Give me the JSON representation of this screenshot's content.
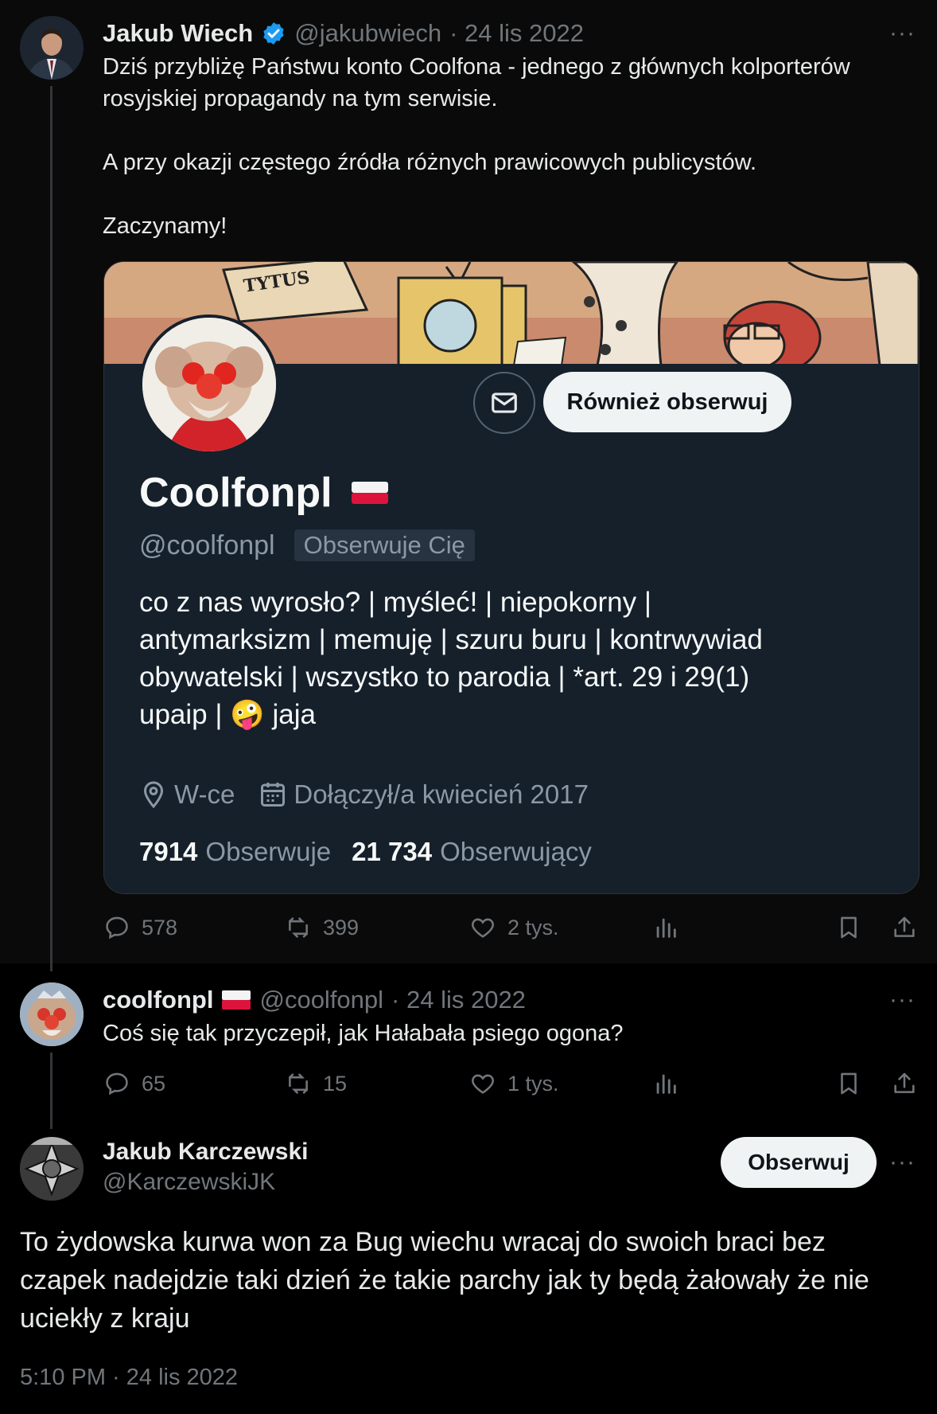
{
  "tweet1": {
    "author_name": "Jakub Wiech",
    "author_handle": "@jakubwiech",
    "date": "· 24 lis 2022",
    "more": "···",
    "text_lines": [
      "Dziś przybliżę Państwu konto Coolfona - jednego z głównych kolporterów",
      "rosyjskiej propagandy na tym serwisie."
    ],
    "text_p2": "A przy okazji częstego źródła różnych prawicowych publicystów.",
    "text_p3": "Zaczynamy!",
    "actions": {
      "replies": "578",
      "retweets": "399",
      "likes": "2 tys."
    }
  },
  "card": {
    "banner_text": "TYTUS",
    "follow_back_label": "Również obserwuj",
    "display_name": "Coolfonpl",
    "handle": "@coolfonpl",
    "follows_you": "Obserwuje Cię",
    "bio_lines": [
      "co z nas wyrosło? | myśleć! | niepokorny |",
      "antymarksizm | memuję | szuru buru | kontrwywiad",
      "obywatelski | wszystko to parodia | *art. 29 i 29(1)",
      "upaip | 🤪 jaja"
    ],
    "location": "W-ce",
    "joined": "Dołączył/a kwiecień 2017",
    "following_count": "7914",
    "following_label": "Obserwuje",
    "followers_count": "21 734",
    "followers_label": "Obserwujący"
  },
  "tweet2": {
    "author_name": "coolfonpl",
    "author_handle": "@coolfonpl",
    "date": "· 24 lis 2022",
    "more": "···",
    "text": "Coś się tak przyczepił, jak Hałabała psiego ogona?",
    "actions": {
      "replies": "65",
      "retweets": "15",
      "likes": "1 tys."
    }
  },
  "tweet3": {
    "author_name": "Jakub Karczewski",
    "author_handle": "@KarczewskiJK",
    "follow_label": "Obserwuj",
    "more": "···",
    "text_lines": [
      "To żydowska kurwa won za Bug wiechu wracaj do swoich braci bez",
      "czapek nadejdzie taki dzień że takie parchy jak ty będą żałowały że nie",
      "uciekły z kraju"
    ],
    "timestamp": "5:10 PM · 24 lis 2022"
  },
  "colors": {
    "background": "#000000",
    "card_bg": "#15202b",
    "verified": "#1d9bf0",
    "muted": "#71767b"
  }
}
